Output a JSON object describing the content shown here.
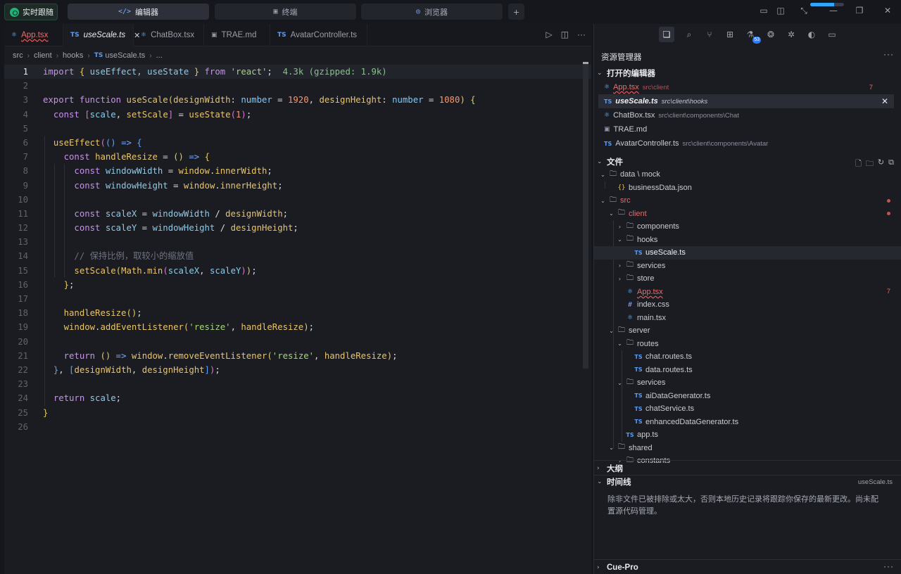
{
  "titlebar": {
    "live_label": "实时跟随",
    "modes": [
      {
        "label": "编辑器",
        "icon": "code-icon"
      },
      {
        "label": "终端",
        "icon": "terminal-icon"
      },
      {
        "label": "浏览器",
        "icon": "compass-icon"
      }
    ],
    "plus": "+",
    "progress": 0.7
  },
  "editor": {
    "tabs": [
      {
        "icon": "⚛",
        "name": "App.tsx",
        "error": true
      },
      {
        "icon": "TS",
        "name": "useScale.ts",
        "active": true,
        "close": "✕"
      },
      {
        "icon": "⚛",
        "name": "ChatBox.tsx"
      },
      {
        "icon": "▣",
        "name": "TRAE.md"
      },
      {
        "icon": "TS",
        "name": "AvatarController.ts"
      }
    ],
    "breadcrumb": [
      "src",
      "client",
      "hooks",
      "TS",
      "useScale.ts",
      "..."
    ],
    "line_numbers": [
      "1",
      "2",
      "3",
      "4",
      "5",
      "6",
      "7",
      "8",
      "9",
      "10",
      "11",
      "12",
      "13",
      "14",
      "15",
      "16",
      "17",
      "18",
      "19",
      "20",
      "21",
      "22",
      "23",
      "24",
      "25",
      "26"
    ],
    "code": {
      "l1": {
        "import": "import",
        "ob": "{",
        "ids": " useEffect, useState ",
        "cb": "}",
        "from": "from",
        "mod": "'react'",
        "semi": ";",
        "hint": "4.3k (gzipped: 1.9k)"
      },
      "l3": {
        "export": "export",
        "function": "function",
        "name": "useScale",
        "op": "(",
        "p1": "designWidth",
        "colon1": ": ",
        "t1": "number",
        "eq1": " = ",
        "v1": "1920",
        "comma": ", ",
        "p2": "designHeight",
        "colon2": ": ",
        "t2": "number",
        "eq2": " = ",
        "v2": "1080",
        "cp": ") ",
        "ob": "{"
      },
      "l4": {
        "const": "const",
        "ob": "[",
        "a": "scale",
        "comma": ", ",
        "b": "setScale",
        "cb": "]",
        "eq": " = ",
        "fn": "useState",
        "op": "(",
        "arg": "1",
        "cp": ")",
        "semi": ";"
      },
      "l6": {
        "fn": "useEffect",
        "op": "(",
        "op2": "()",
        "arrow": " => ",
        "ob": "{"
      },
      "l7": {
        "const": "const",
        "name": "handleResize",
        "eq": " = ",
        "args": "()",
        "arrow": " => ",
        "ob": "{"
      },
      "l8": {
        "const": "const",
        "name": "windowWidth",
        "eq": " = ",
        "obj": "window",
        "dot": ".",
        "prop": "innerWidth",
        "semi": ";"
      },
      "l9": {
        "const": "const",
        "name": "windowHeight",
        "eq": " = ",
        "obj": "window",
        "dot": ".",
        "prop": "innerHeight",
        "semi": ";"
      },
      "l11": {
        "const": "const",
        "name": "scaleX",
        "eq": " = ",
        "a": "windowWidth",
        "div": " / ",
        "b": "designWidth",
        "semi": ";"
      },
      "l12": {
        "const": "const",
        "name": "scaleY",
        "eq": " = ",
        "a": "windowHeight",
        "div": " / ",
        "b": "designHeight",
        "semi": ";"
      },
      "l14": {
        "comment": "// 保持比例，取较小的缩放值"
      },
      "l15": {
        "fn": "setScale",
        "op": "(",
        "obj": "Math",
        "dot": ".",
        "m": "min",
        "op2": "(",
        "a": "scaleX",
        "comma": ", ",
        "b": "scaleY",
        "cp2": ")",
        "cp": ")",
        "semi": ";"
      },
      "l16": {
        "cb": "}",
        "semi": ";"
      },
      "l18": {
        "fn": "handleResize",
        "args": "()",
        "semi": ";"
      },
      "l19": {
        "obj": "window",
        "dot": ".",
        "m": "addEventListener",
        "op": "(",
        "s": "'resize'",
        "comma": ", ",
        "a": "handleResize",
        "cp": ")",
        "semi": ";"
      },
      "l21": {
        "ret": "return",
        "args": " ()",
        "arrow": " => ",
        "obj": "window",
        "dot": ".",
        "m": "removeEventListener",
        "op": "(",
        "s": "'resize'",
        "comma": ", ",
        "a": "handleResize",
        "cp": ")",
        "semi": ";"
      },
      "l22": {
        "cb": "}",
        "comma": ", ",
        "ob": "[",
        "a": "designWidth",
        "comma2": ", ",
        "b": "designHeight",
        "cb2": "]",
        "cp": ")",
        "semi": ";"
      },
      "l24": {
        "ret": "return",
        "v": " scale",
        "semi": ";"
      },
      "l25": {
        "cb": "}"
      }
    }
  },
  "explorer": {
    "title": "资源管理器",
    "more": "···",
    "activity_badge": "53",
    "open_editors": {
      "header": "打开的编辑器",
      "items": [
        {
          "icon": "⚛",
          "name": "App.tsx",
          "path": "src\\client",
          "count": "7",
          "error": true
        },
        {
          "icon": "TS",
          "name": "useScale.ts",
          "path": "src\\client\\hooks",
          "active": true,
          "close": "✕"
        },
        {
          "icon": "⚛",
          "name": "ChatBox.tsx",
          "path": "src\\client\\components\\Chat"
        },
        {
          "icon": "▣",
          "name": "TRAE.md",
          "path": ""
        },
        {
          "icon": "TS",
          "name": "AvatarController.ts",
          "path": "src\\client\\components\\Avatar"
        }
      ]
    },
    "files": {
      "header": "文件",
      "tree": [
        {
          "chev": "⌄",
          "icon": "folder",
          "name": "data \\ mock"
        },
        {
          "chev": "",
          "icon": "json",
          "name": "businessData.json"
        },
        {
          "chev": "⌄",
          "icon": "folder",
          "name": "src",
          "red": true,
          "dot": true
        },
        {
          "chev": "⌄",
          "icon": "folder",
          "name": "client",
          "red": true,
          "dot": true
        },
        {
          "chev": "›",
          "icon": "folder",
          "name": "components"
        },
        {
          "chev": "⌄",
          "icon": "folder",
          "name": "hooks"
        },
        {
          "chev": "",
          "icon": "ts",
          "name": "useScale.ts",
          "selected": true
        },
        {
          "chev": "›",
          "icon": "folder",
          "name": "services"
        },
        {
          "chev": "›",
          "icon": "folder",
          "name": "store"
        },
        {
          "chev": "",
          "icon": "react",
          "name": "App.tsx",
          "red": true,
          "error": true,
          "count": "7"
        },
        {
          "chev": "",
          "icon": "css",
          "name": "index.css"
        },
        {
          "chev": "",
          "icon": "react",
          "name": "main.tsx"
        },
        {
          "chev": "⌄",
          "icon": "folder",
          "name": "server"
        },
        {
          "chev": "⌄",
          "icon": "folder",
          "name": "routes"
        },
        {
          "chev": "",
          "icon": "ts",
          "name": "chat.routes.ts"
        },
        {
          "chev": "",
          "icon": "ts",
          "name": "data.routes.ts"
        },
        {
          "chev": "⌄",
          "icon": "folder",
          "name": "services"
        },
        {
          "chev": "",
          "icon": "ts",
          "name": "aiDataGenerator.ts"
        },
        {
          "chev": "",
          "icon": "ts",
          "name": "chatService.ts"
        },
        {
          "chev": "",
          "icon": "ts",
          "name": "enhancedDataGenerator.ts"
        },
        {
          "chev": "",
          "icon": "ts",
          "name": "app.ts"
        },
        {
          "chev": "⌄",
          "icon": "folder",
          "name": "shared"
        },
        {
          "chev": "›",
          "icon": "folder",
          "name": "constants"
        }
      ]
    },
    "outline": {
      "header": "大纲"
    },
    "timeline": {
      "header": "时间线",
      "file": "useScale.ts",
      "hint": "除非文件已被排除或太大，否则本地历史记录将跟踪你保存的最新更改。尚未配置源代码管理。"
    },
    "cue": {
      "header": "Cue-Pro",
      "more": "···"
    }
  }
}
